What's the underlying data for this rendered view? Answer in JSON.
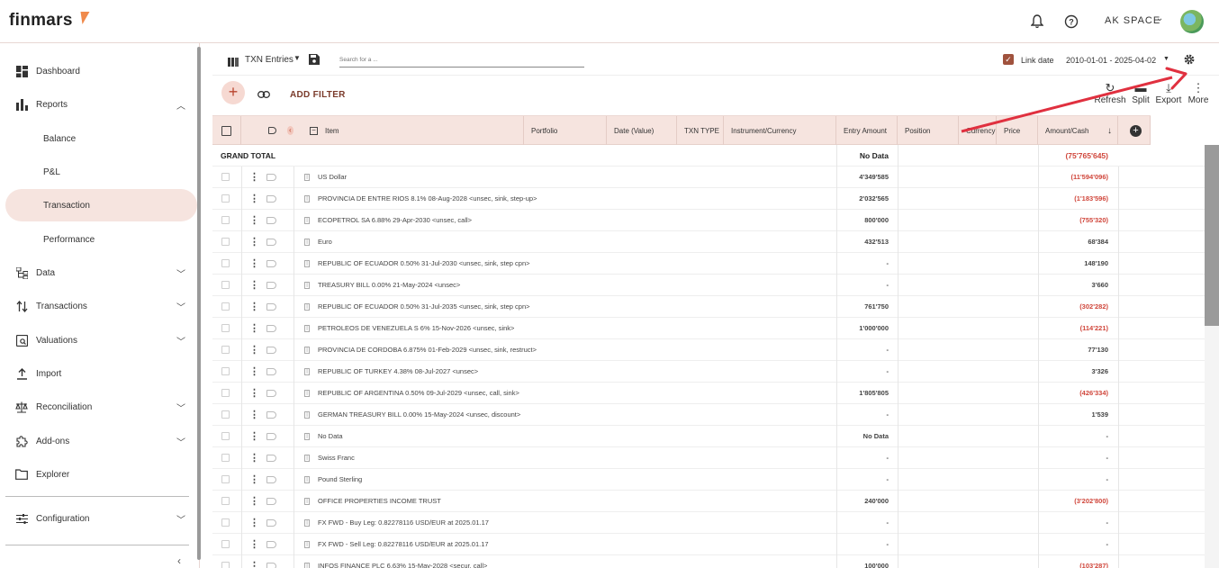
{
  "app": {
    "logo": "finmars"
  },
  "header": {
    "space_name": "AK SPACE",
    "bell_icon": "bell-icon",
    "help_icon": "help-icon"
  },
  "sidebar": {
    "items": [
      {
        "label": "Dashboard",
        "icon": "dashboard-icon"
      },
      {
        "label": "Reports",
        "icon": "bar-chart-icon"
      },
      {
        "label": "Balance"
      },
      {
        "label": "P&L"
      },
      {
        "label": "Transaction"
      },
      {
        "label": "Performance"
      },
      {
        "label": "Data",
        "icon": "data-tree-icon"
      },
      {
        "label": "Transactions",
        "icon": "transactions-arrows-icon"
      },
      {
        "label": "Valuations",
        "icon": "valuations-icon"
      },
      {
        "label": "Import",
        "icon": "upload-icon"
      },
      {
        "label": "Reconciliation",
        "icon": "balance-scale-icon"
      },
      {
        "label": "Add-ons",
        "icon": "puzzle-icon"
      },
      {
        "label": "Explorer",
        "icon": "folder-icon"
      },
      {
        "label": "Configuration",
        "icon": "sliders-icon"
      }
    ]
  },
  "toolbar": {
    "layout_name": "TXN Entries",
    "search_placeholder": "Search for a ...",
    "link_date_label": "Link date",
    "date_range": "2010-01-01 - 2025-04-02",
    "add_filter": "ADD FILTER",
    "refresh": "Refresh",
    "split": "Split",
    "export": "Export",
    "more": "More"
  },
  "grid": {
    "columns": [
      "Item",
      "Portfolio",
      "Date (Value)",
      "TXN TYPE",
      "Instrument/Currency",
      "Entry Amount",
      "Position",
      "Currency",
      "Price",
      "Amount/Cash"
    ],
    "grand_total": {
      "label": "GRAND TOTAL",
      "entry_amount": "No Data",
      "amount_cash": "(75'765'645)"
    },
    "rows": [
      {
        "item": "US Dollar",
        "entry": "4'349'585",
        "cash": "(11'594'096)",
        "neg": true
      },
      {
        "item": "PROVINCIA DE ENTRE RIOS  8.1%  08-Aug-2028  <unsec, sink, step-up>",
        "entry": "2'032'565",
        "cash": "(1'183'596)",
        "neg": true
      },
      {
        "item": "ECOPETROL SA  6.88%  29-Apr-2030  <unsec, call>",
        "entry": "800'000",
        "cash": "(755'320)",
        "neg": true
      },
      {
        "item": "Euro",
        "entry": "432'513",
        "cash": "68'384",
        "neg": false
      },
      {
        "item": "REPUBLIC OF ECUADOR  0.50%  31-Jul-2030  <unsec, sink, step cpn>",
        "entry": "-",
        "cash": "148'190",
        "neg": false
      },
      {
        "item": "TREASURY BILL  0.00%  21-May-2024  <unsec>",
        "entry": "-",
        "cash": "3'660",
        "neg": false
      },
      {
        "item": "REPUBLIC OF ECUADOR  0.50%  31-Jul-2035  <unsec, sink, step cpn>",
        "entry": "761'750",
        "cash": "(302'282)",
        "neg": true
      },
      {
        "item": "PETROLEOS DE VENEZUELA S  6%  15-Nov-2026  <unsec, sink>",
        "entry": "1'000'000",
        "cash": "(114'221)",
        "neg": true
      },
      {
        "item": "PROVINCIA DE CORDOBA  6.875%  01-Feb-2029  <unsec, sink, restruct>",
        "entry": "-",
        "cash": "77'130",
        "neg": false
      },
      {
        "item": "REPUBLIC OF TURKEY  4.38%  08-Jul-2027  <unsec>",
        "entry": "-",
        "cash": "3'326",
        "neg": false
      },
      {
        "item": "REPUBLIC OF ARGENTINA  0.50%  09-Jul-2029  <unsec, call, sink>",
        "entry": "1'805'805",
        "cash": "(426'334)",
        "neg": true
      },
      {
        "item": "GERMAN TREASURY BILL  0.00%  15-May-2024  <unsec, discount>",
        "entry": "-",
        "cash": "1'539",
        "neg": false
      },
      {
        "item": "No Data",
        "entry": "No Data",
        "cash": "-",
        "neg": false
      },
      {
        "item": "Swiss Franc",
        "entry": "-",
        "cash": "-",
        "neg": false
      },
      {
        "item": "Pound Sterling",
        "entry": "-",
        "cash": "-",
        "neg": false
      },
      {
        "item": "OFFICE PROPERTIES INCOME TRUST",
        "entry": "240'000",
        "cash": "(3'202'800)",
        "neg": true
      },
      {
        "item": "FX FWD - Buy Leg: 0.82278116 USD/EUR at 2025.01.17",
        "entry": "-",
        "cash": "-",
        "neg": false
      },
      {
        "item": "FX FWD - Sell Leg: 0.82278116 USD/EUR at 2025.01.17",
        "entry": "-",
        "cash": "-",
        "neg": false
      },
      {
        "item": "INFOS FINANCE PLC  6.63%  15-May-2028  <secur, call>",
        "entry": "100'000",
        "cash": "(103'287)",
        "neg": true
      }
    ]
  },
  "colors": {
    "accent": "#f6e4df",
    "negative": "#d0463b",
    "annotation_arrow": "#e0303f"
  }
}
